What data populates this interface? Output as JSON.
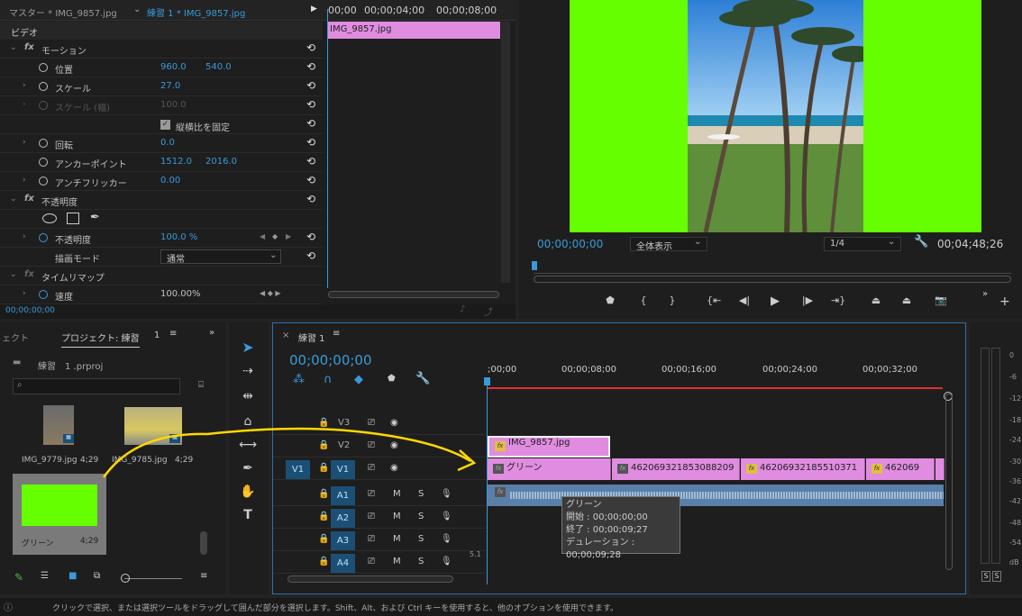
{
  "effects_panel": {
    "tab_master": "マスター * IMG_9857.jpg",
    "tab_sequence": "練習 1 * IMG_9857.jpg",
    "section_video": "ビデオ",
    "motion": "モーション",
    "position_label": "位置",
    "position_x": "960.0",
    "position_y": "540.0",
    "scale_label": "スケール",
    "scale_value": "27.0",
    "scale_width_label": "スケール (幅)",
    "scale_width_value": "100.0",
    "uniform_scale_label": "縦横比を固定",
    "rotation_label": "回転",
    "rotation_value": "0.0",
    "anchor_label": "アンカーポイント",
    "anchor_x": "1512.0",
    "anchor_y": "2016.0",
    "antiflicker_label": "アンチフリッカー",
    "antiflicker_value": "0.00",
    "opacity_section": "不透明度",
    "opacity_label": "不透明度",
    "opacity_value": "100.0 %",
    "blend_label": "描画モード",
    "blend_value": "通常",
    "time_remap": "タイムリマップ",
    "speed_label": "速度",
    "speed_value": "100.00%",
    "footer_time": "00;00;00;00",
    "mini_timeline_start": "00;00",
    "mini_timeline_a": "00;00;04;00",
    "mini_timeline_b": "00;00;08;00",
    "mini_clip": "IMG_9857.jpg"
  },
  "program_monitor": {
    "timecode": "00;00;00;00",
    "fit_label": "全体表示",
    "quality": "1/4",
    "duration": "00;04;48;26"
  },
  "project_panel": {
    "tab_left": "ェクト",
    "tab_project": "プロジェクト: 練習",
    "tab_num": "1",
    "file_name": "練習　1 .prproj",
    "items": [
      {
        "name": "IMG_9779.jpg",
        "dur": "4;29"
      },
      {
        "name": "IMG_9785.jpg",
        "dur": "4;29"
      },
      {
        "name": "グリーン",
        "dur": "4;29"
      }
    ]
  },
  "timeline": {
    "tab": "練習 1",
    "timecode": "00;00;00;00",
    "ruler": [
      ";00;00",
      "00;00;08;00",
      "00;00;16;00",
      "00;00;24;00",
      "00;00;32;00"
    ],
    "tracks_video": [
      "V3",
      "V2",
      "V1"
    ],
    "tracks_audio": [
      "A1",
      "A2",
      "A3",
      "A4"
    ],
    "src_v1": "V1",
    "m_label": "M",
    "s_label": "S",
    "mix_label": "5.1",
    "clip_v2": "IMG_9857.jpg",
    "clip_v1_a": "グリーン",
    "clip_v1_b": "46206932185308820​9",
    "clip_v1_c": "46206932185510371",
    "clip_v1_d": "462069",
    "tooltip": {
      "title": "グリーン",
      "start": "開始 : 00;00;00;00",
      "end": "終了 : 00;00;09;27",
      "dur": "デュレーション : 00;00;09;28"
    }
  },
  "meter": {
    "labels": [
      "0",
      "-6",
      "-12",
      "-18",
      "-24",
      "-30",
      "-36",
      "-42",
      "-48",
      "-54"
    ],
    "db": "dB",
    "s1": "S",
    "s2": "S"
  },
  "status_bar": "クリックで選択、または選択ツールをドラッグして囲んだ部分を選択します。Shift、Alt、および Ctrl キーを使用すると、他のオプションを使用できます。",
  "colors": {
    "accent": "#3a9ad9",
    "green_matte": "#66ff00",
    "clip_pink": "#e08ce0",
    "arrow": "#ffd800"
  }
}
